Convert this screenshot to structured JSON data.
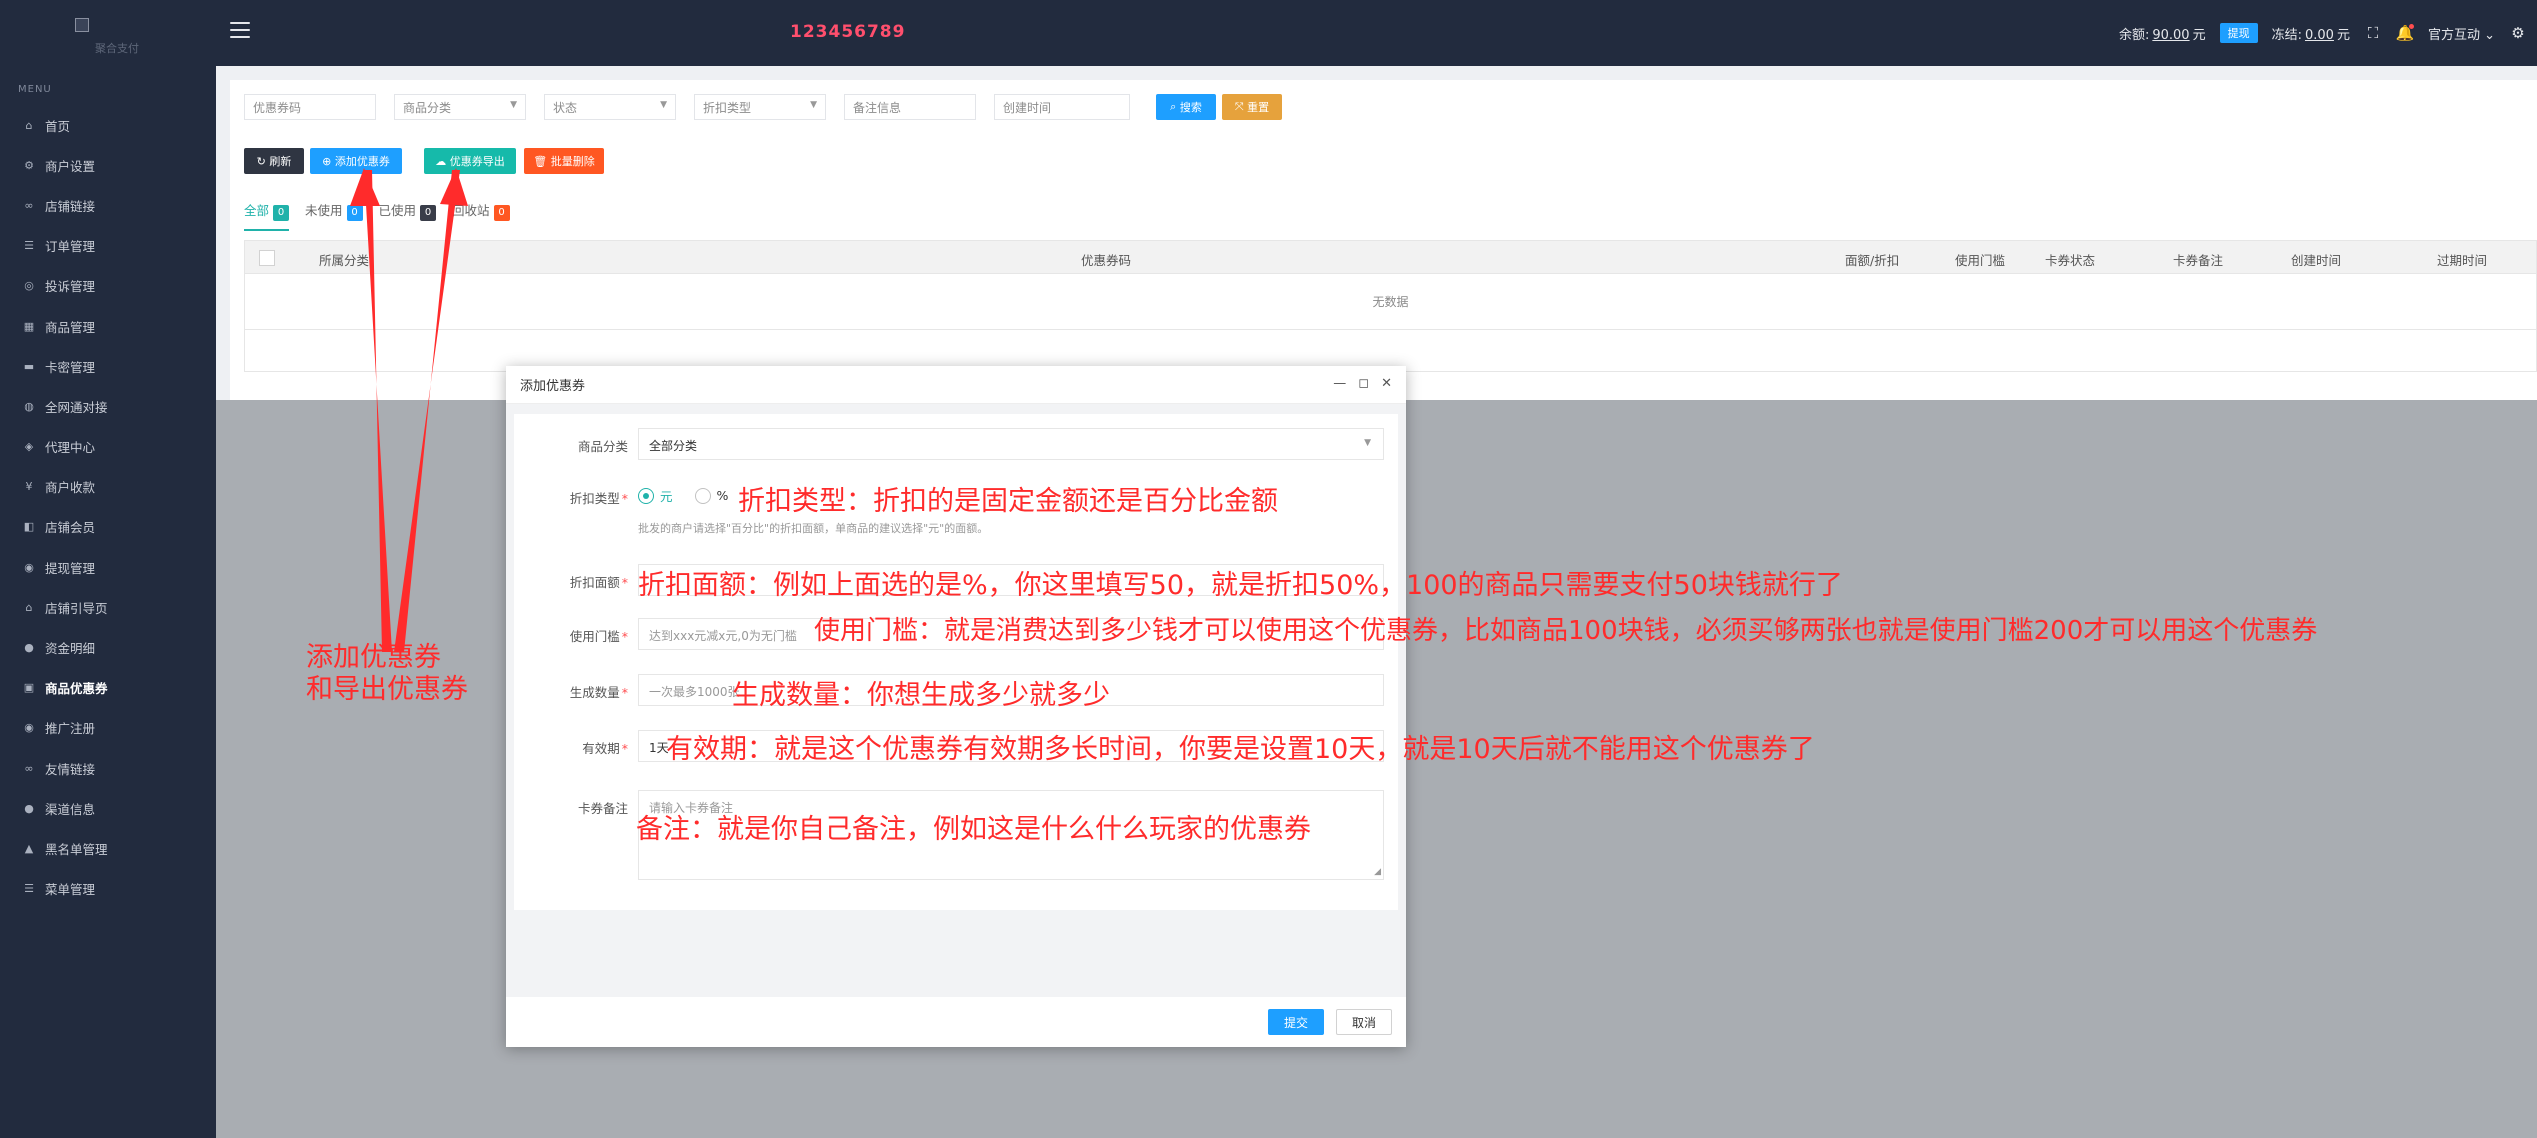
{
  "sidebar": {
    "logo_sub": "聚合支付",
    "menu_heading": "MENU",
    "items": [
      {
        "label": "首页",
        "icon": "home-icon",
        "glyph": "⌂"
      },
      {
        "label": "商户设置",
        "icon": "gear-icon",
        "glyph": "⚙"
      },
      {
        "label": "店铺链接",
        "icon": "link-icon",
        "glyph": "∞"
      },
      {
        "label": "订单管理",
        "icon": "list-icon",
        "glyph": "☰"
      },
      {
        "label": "投诉管理",
        "icon": "headset-icon",
        "glyph": "◎"
      },
      {
        "label": "商品管理",
        "icon": "grid-icon",
        "glyph": "▦"
      },
      {
        "label": "卡密管理",
        "icon": "card-icon",
        "glyph": "▬"
      },
      {
        "label": "全网通对接",
        "icon": "globe-icon",
        "glyph": "◍"
      },
      {
        "label": "代理中心",
        "icon": "shield-icon",
        "glyph": "◈"
      },
      {
        "label": "商户收款",
        "icon": "money-icon",
        "glyph": "¥"
      },
      {
        "label": "店铺会员",
        "icon": "member-icon",
        "glyph": "◧"
      },
      {
        "label": "提现管理",
        "icon": "withdraw-icon",
        "glyph": "◉"
      },
      {
        "label": "店铺引导页",
        "icon": "store-icon",
        "glyph": "⌂"
      },
      {
        "label": "资金明细",
        "icon": "fund-icon",
        "glyph": "●"
      },
      {
        "label": "商品优惠券",
        "icon": "coupon-icon",
        "glyph": "▣",
        "active": true
      },
      {
        "label": "推广注册",
        "icon": "promo-icon",
        "glyph": "◉"
      },
      {
        "label": "友情链接",
        "icon": "friend-link-icon",
        "glyph": "∞"
      },
      {
        "label": "渠道信息",
        "icon": "info-icon",
        "glyph": "●"
      },
      {
        "label": "黑名单管理",
        "icon": "blacklist-icon",
        "glyph": "▲"
      },
      {
        "label": "菜单管理",
        "icon": "menu-icon",
        "glyph": "☰"
      }
    ]
  },
  "topbar": {
    "code": "123456789",
    "balance_label": "余额:",
    "balance_value": "90.00",
    "unit": "元",
    "withdraw_label": "提现",
    "frozen_label": "冻结:",
    "frozen_value": "0.00",
    "user_name": "官方互动"
  },
  "filters": {
    "coupon_code": "优惠券码",
    "category": "商品分类",
    "status": "状态",
    "discount_type": "折扣类型",
    "remark": "备注信息",
    "created_time": "创建时间",
    "search_label": "搜索",
    "reset_label": "重置"
  },
  "toolbar": {
    "refresh_label": "刷新",
    "add_label": "添加优惠券",
    "export_label": "优惠券导出",
    "batch_delete_label": "批量删除"
  },
  "tabs": [
    {
      "label": "全部",
      "count": "0",
      "color": "#20b2aa"
    },
    {
      "label": "未使用",
      "count": "0",
      "color": "#1e9fff"
    },
    {
      "label": "已使用",
      "count": "0",
      "color": "#393d49"
    },
    {
      "label": "回收站",
      "count": "0",
      "color": "#ff5722"
    }
  ],
  "table": {
    "headers": [
      "所属分类",
      "优惠券码",
      "面额/折扣",
      "使用门槛",
      "卡券状态",
      "卡券备注",
      "创建时间",
      "过期时间"
    ],
    "empty_text": "无数据"
  },
  "modal": {
    "title": "添加优惠券",
    "category_label": "商品分类",
    "category_value": "全部分类",
    "discount_type_label": "折扣类型",
    "option_yuan": "元",
    "option_percent": "%",
    "discount_hint": "批发的商户请选择\"百分比\"的折扣面额，单商品的建议选择\"元\"的面额。",
    "amount_label": "折扣面额",
    "threshold_label": "使用门槛",
    "threshold_placeholder": "达到xxx元减x元,0为无门槛",
    "quantity_label": "生成数量",
    "quantity_placeholder": "一次最多1000张",
    "validity_label": "有效期",
    "validity_value": "1天",
    "remark_label": "卡券备注",
    "remark_placeholder": "请输入卡券备注",
    "submit_label": "提交",
    "cancel_label": "取消"
  },
  "annotations": {
    "add_export": "添加优惠券",
    "add_export_2": "和导出优惠券",
    "discount_type": "折扣类型：折扣的是固定金额还是百分比金额",
    "amount": "折扣面额：例如上面选的是%，你这里填写50，就是折扣50%，100的商品只需要支付50块钱就行了",
    "threshold": "使用门槛：就是消费达到多少钱才可以使用这个优惠券，比如商品100块钱，必须买够两张也就是使用门槛200才可以用这个优惠券",
    "quantity": "生成数量：你想生成多少就多少",
    "validity": "有效期：就是这个优惠券有效期多长时间，你要是设置10天，就是10天后就不能用这个优惠券了",
    "remark": "备注：就是你自己备注，例如这是什么什么玩家的优惠券",
    "color": "#ff2b2b"
  }
}
